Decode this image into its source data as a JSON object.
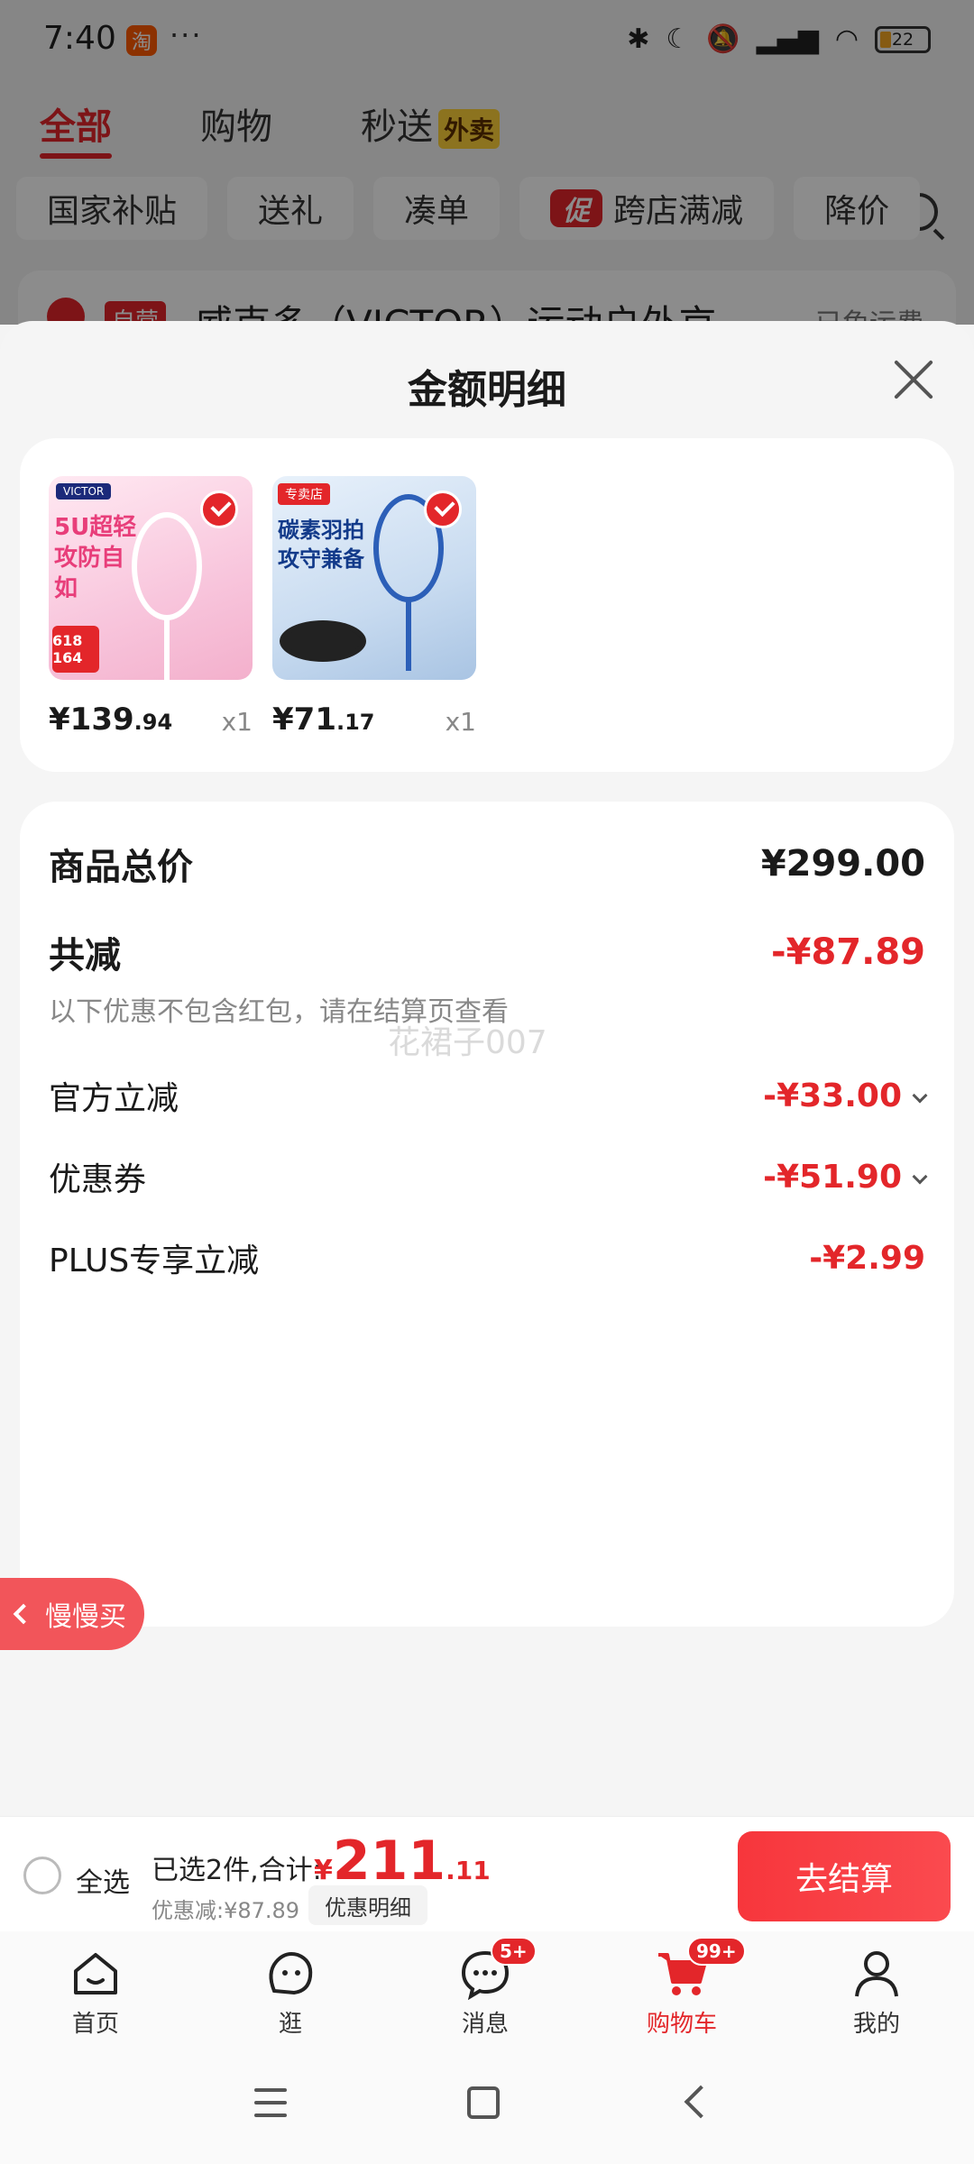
{
  "status_bar": {
    "time": "7:40",
    "app_icon": "淘",
    "more": "···",
    "battery": "22"
  },
  "cart_tabs": [
    {
      "label": "全部"
    },
    {
      "label": "购物"
    },
    {
      "label": "秒送",
      "badge": "外卖"
    }
  ],
  "filter_chips": [
    {
      "label": "国家补贴"
    },
    {
      "label": "送礼"
    },
    {
      "label": "凑单"
    },
    {
      "label": "跨店满减",
      "promo": "促"
    },
    {
      "label": "降价"
    }
  ],
  "store": {
    "tag": "自营",
    "name": "威克多（VICTOR）运动户外京",
    "shipping": "已免运费"
  },
  "sheet": {
    "title": "金额明细"
  },
  "products": [
    {
      "price_int": "¥139",
      "price_dec": ".94",
      "qty": "x1",
      "brand": "VICTOR",
      "headline": "5U超轻 攻防自如",
      "tag": "618 164"
    },
    {
      "price_int": "¥71",
      "price_dec": ".17",
      "qty": "x1",
      "brand": "专卖店",
      "headline": "碳素羽拍 攻守兼备"
    }
  ],
  "summary": {
    "total_label": "商品总价",
    "total_value": "¥299.00",
    "reduce_label": "共减",
    "reduce_value": "-¥87.89",
    "note": "以下优惠不包含红包，请在结算页查看",
    "watermark": "花裙子007",
    "items": [
      {
        "label": "官方立减",
        "value": "-¥33.00",
        "expandable": true
      },
      {
        "label": "优惠券",
        "value": "-¥51.90",
        "expandable": true
      },
      {
        "label": "PLUS专享立减",
        "value": "-¥2.99",
        "expandable": false
      }
    ]
  },
  "slow_buy": "慢慢买",
  "checkout": {
    "select_all": "全选",
    "selected_text": "已选2件,合计:",
    "currency": "¥",
    "total_int": "211",
    "total_dec": ".11",
    "discount_text": "优惠减:¥87.89",
    "detail_button": "优惠明细",
    "pay_button": "去结算"
  },
  "bottom_nav": [
    {
      "label": "首页",
      "icon": "home-icon"
    },
    {
      "label": "逛",
      "icon": "explore-icon"
    },
    {
      "label": "消息",
      "icon": "message-icon",
      "badge": "5+"
    },
    {
      "label": "购物车",
      "icon": "cart-icon",
      "badge": "99+",
      "active": true
    },
    {
      "label": "我的",
      "icon": "profile-icon"
    }
  ],
  "colors": {
    "accent": "#e3262a",
    "button": "#f7363c",
    "background": "#f5f5f5"
  }
}
